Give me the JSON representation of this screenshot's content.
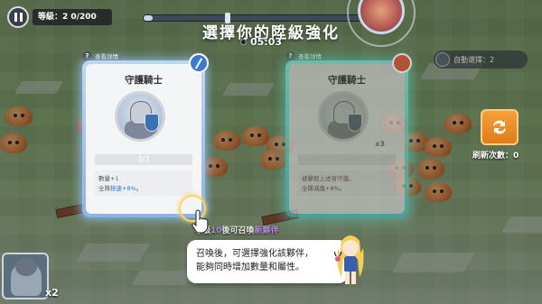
{
  "hud": {
    "level_label": "等級：2 0/200",
    "timer": "05:03",
    "screen_title": "選擇你的陞級強化",
    "right_control_label": "自動選擇：2",
    "level_progress_fraction": 0.04
  },
  "cards": [
    {
      "header_label": "查看詳情",
      "name": "守護騎士",
      "star_strip": "3/3",
      "desc_line1_prefix": "數量+",
      "desc_line1_value": "1",
      "desc_line2_prefix": "全隊",
      "desc_line2_value": "移速+8%",
      "desc_line2_suffix": "。",
      "selected": true,
      "accent_color": "#3c79d4",
      "corner_icon": "sword-icon"
    },
    {
      "header_label": "查看詳情",
      "name": "守護騎士",
      "star_strip": "",
      "multiplier": "x3",
      "desc_line1_prefix": "",
      "desc_line1_value": "被擊殺上述身守護。",
      "desc_line2_prefix": "全隊",
      "desc_line2_value": "減傷+8%",
      "desc_line2_suffix": "。",
      "selected": false,
      "accent_color": "#d44a34",
      "corner_icon": "shield-icon"
    }
  ],
  "refresh": {
    "label": "刷新次數：0",
    "button_color": "#f09a30"
  },
  "unlock_hint": {
    "prefix": "等級",
    "value": "10",
    "middle": "後可召喚",
    "suffix": "新夥伴"
  },
  "dialogue": {
    "line1": "召喚後，可選擇強化該夥伴，",
    "line2": "能夠同時增加數量和屬性。"
  },
  "hero_slot": {
    "count": "x2"
  }
}
